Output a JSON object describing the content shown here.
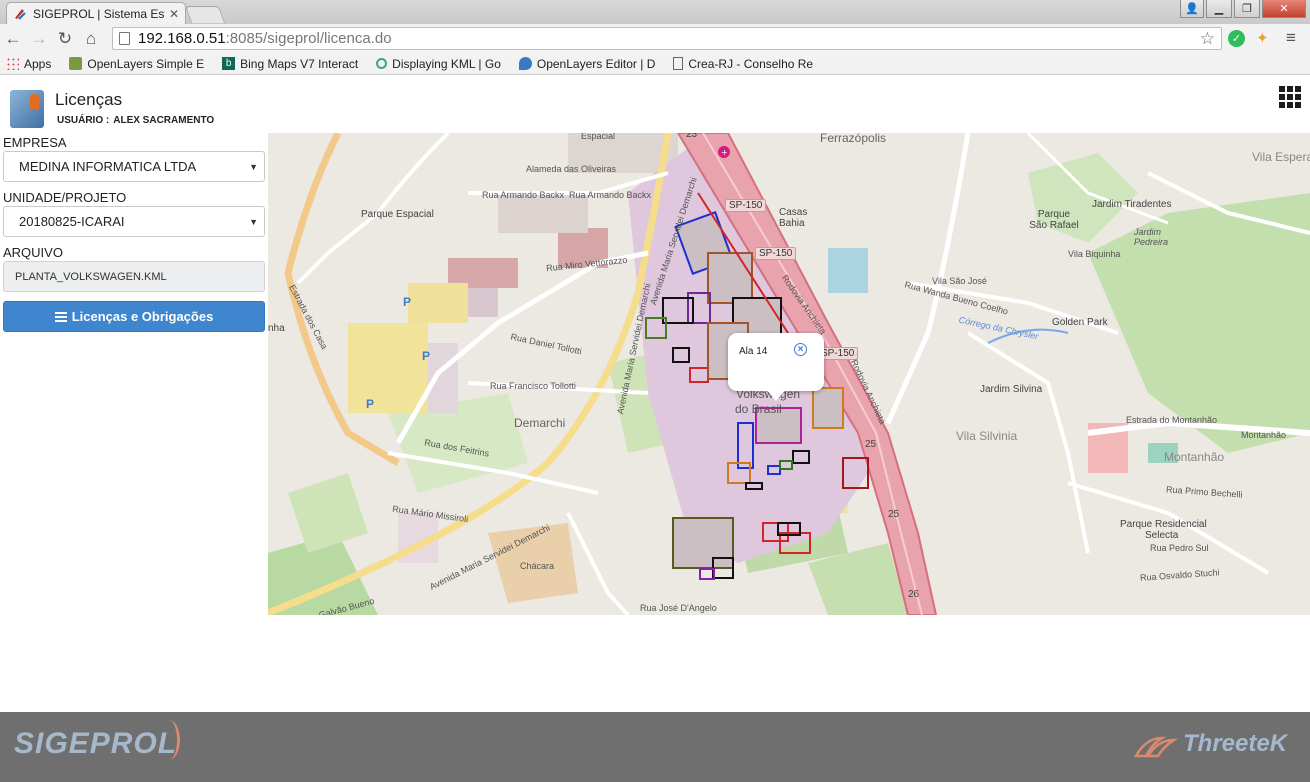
{
  "browser": {
    "tab_title": "SIGEPROL | Sistema Estrat",
    "window_title": "",
    "url_host": "192.168.0.51",
    "url_rest": ":8085/sigeprol/licenca.do",
    "bookmarks": [
      {
        "label": "Apps",
        "icon": "apps-grid-icon"
      },
      {
        "label": "OpenLayers Simple E",
        "icon": "openlayers-icon"
      },
      {
        "label": "Bing Maps V7 Interact",
        "icon": "bing-icon"
      },
      {
        "label": "Displaying KML | Go",
        "icon": "kml-icon"
      },
      {
        "label": "OpenLayers Editor | D",
        "icon": "openlayers-editor-icon"
      },
      {
        "label": "Crea-RJ - Conselho Re",
        "icon": "page-icon"
      }
    ]
  },
  "header": {
    "title": "Licenças",
    "user_label": "USUÁRIO :",
    "user_name": "ALEX SACRAMENTO"
  },
  "form": {
    "empresa_label": "EMPRESA",
    "empresa_value": "MEDINA INFORMATICA LTDA",
    "unidade_label": "UNIDADE/PROJETO",
    "unidade_value": "20180825-ICARAI",
    "arquivo_label": "ARQUIVO",
    "arquivo_value": "PLANTA_VOLKSWAGEN.KML",
    "button_label": "Licenças e Obrigações"
  },
  "map": {
    "popup_text": "Ala 14",
    "labels": {
      "ferrazopolis": "Ferrazópolis",
      "espacial": "Espacial",
      "alameda": "Alameda das Oliveiras",
      "armando1": "Rua Armando Backx",
      "armando2": "Rua Armando Backx",
      "parque_espacial": "Parque Espacial",
      "miro": "Rua Miro Vettorazzo",
      "sp150a": "SP-150",
      "sp150b": "SP-150",
      "sp150c": "SP-150",
      "casas_bahia": "Casas Bahia",
      "vila_sao_jose": "Vila São José",
      "wanda": "Rua Wanda Bueno Coelho",
      "golden_park": "Golden Park",
      "jardim_tiradentes": "Jardim Tiradentes",
      "parque_sao_rafael": "Parque São Rafael",
      "jardim_pedreira": "Jardim Pedreira",
      "vila_biquinha": "Vila Biquinha",
      "vila_esperanca": "Vila Esperanç",
      "jardim_silvina": "Jardim Silvina",
      "vila_silvinia": "Vila Silvinia",
      "estrada_montanhao": "Estrada do Montanhão",
      "montanhao": "Montanhão",
      "montanhao_small": "Montanhão",
      "parque_residencial": "Parque Residencial",
      "selecta": "Selecta",
      "pedro_sul": "Rua Pedro Sul",
      "osvaldo": "Rua Osvaldo Stuchi",
      "primo": "Rua Primo Bechelli",
      "demarchi": "Demarchi",
      "tollotti": "Rua Francisco Tollotti",
      "daniel": "Rua Daniel Tollotti",
      "feitrins": "Rua dos Feitrins",
      "mario": "Rua Mário Missiroli",
      "chacara": "Chácara",
      "jose_dangelo": "Rua José D'Angelo",
      "volkswagen1": "Volkswagen",
      "volkswagen2": "do Brasil",
      "nha": "nha",
      "num23": "23",
      "num25a": "25",
      "num25b": "25",
      "num26": "26",
      "avenida1": "Avenida Maria Servidei Demarchi",
      "avenida2": "Avenida Maria Servidei Demarchi",
      "avenida3": "Avenida Maria Servidei Demarchi",
      "rodovia1": "Rodovia Anchieta",
      "rodovia2": "Rodovia Anchieta",
      "estrada_casa": "Estrada dos Casa",
      "galvao": "Galvão Bueno",
      "corrego": "Córrego da Chrysler",
      "parking": "P"
    }
  },
  "footer": {
    "brand": "SIGEPROL",
    "vendor": "ThreeteK"
  }
}
